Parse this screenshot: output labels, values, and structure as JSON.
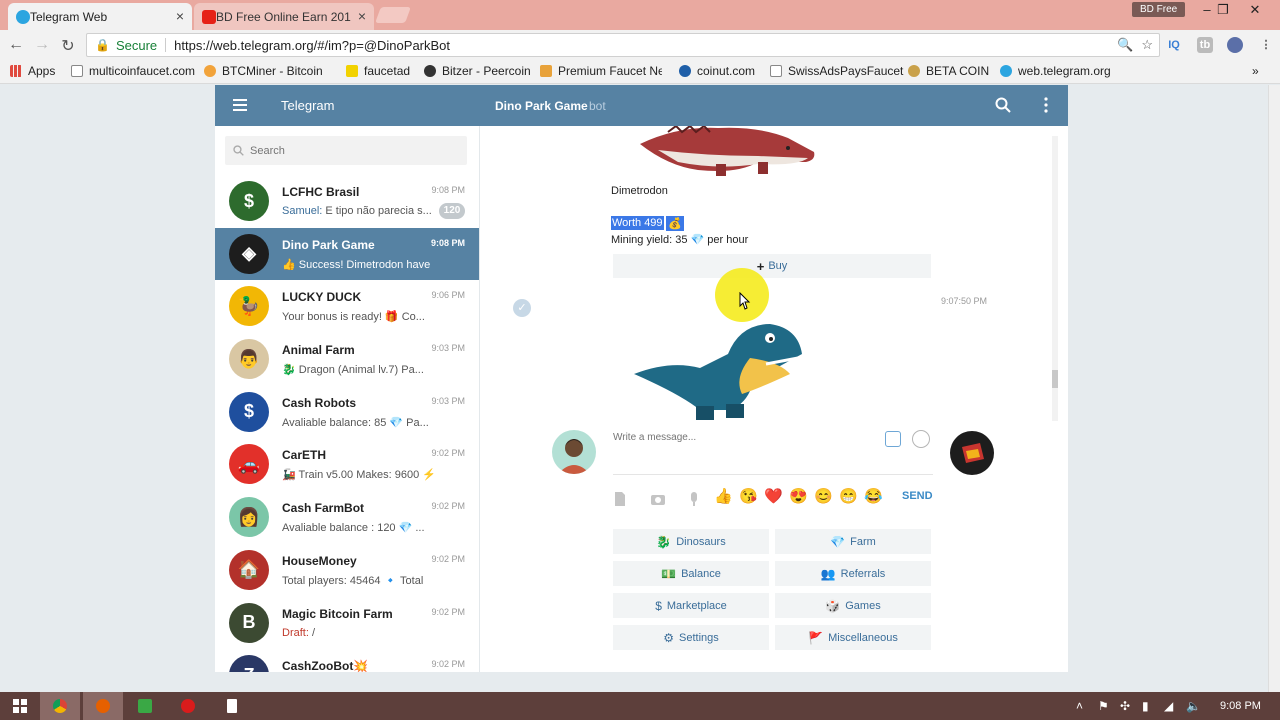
{
  "browser": {
    "tabs": [
      {
        "label": "Telegram Web",
        "active": true
      },
      {
        "label": "BD Free Online Earn 201",
        "active": false
      }
    ],
    "profile_name": "BD Free",
    "address": {
      "secure_label": "Secure",
      "url": "https://web.telegram.org/#/im?p=@DinoParkBot"
    },
    "extensions": [
      "IQ",
      "tb"
    ],
    "bookmarks": [
      {
        "label": "Apps",
        "color": "#e04a3f"
      },
      {
        "label": "multicoinfaucet.com",
        "color": "#ffffff"
      },
      {
        "label": "BTCMiner - Bitcoin m",
        "color": "#f2a33a"
      },
      {
        "label": "faucetad",
        "color": "#f2d200"
      },
      {
        "label": "Bitzer - Peercoin",
        "color": "#333333"
      },
      {
        "label": "Premium Faucet Netw",
        "color": "#e8a23a"
      },
      {
        "label": "coinut.com",
        "color": "#1f5fa8"
      },
      {
        "label": "SwissAdsPaysFaucet",
        "color": "#ffffff"
      },
      {
        "label": "BETA COIN",
        "color": "#c9a14a"
      },
      {
        "label": "web.telegram.org",
        "color": "#2ca5e0"
      }
    ]
  },
  "telegram": {
    "app_title": "Telegram",
    "peer": {
      "name": "Dino Park Game",
      "subtitle": "bot"
    },
    "search_placeholder": "Search",
    "dialogs": [
      {
        "name": "LCFHC Brasil",
        "time": "9:08 PM",
        "from": "Samuel:",
        "message": " E tipo não parecia s...",
        "badge": "120",
        "avatar_color": "#2d6b2d",
        "avatar_letter": "$"
      },
      {
        "name": "Dino Park Game",
        "time": "9:08 PM",
        "message": "👍 Success! Dimetrodon have",
        "active": true,
        "avatar_color": "#1d1d1d",
        "avatar_letter": "◈"
      },
      {
        "name": "LUCKY DUCK",
        "time": "9:06 PM",
        "message": "Your bonus is ready! 🎁 Co...",
        "avatar_color": "#f2b705",
        "avatar_letter": "🦆"
      },
      {
        "name": "Animal Farm",
        "time": "9:03 PM",
        "message": "🐉 Dragon (Animal lv.7) Pa...",
        "avatar_color": "#d9c7a3",
        "avatar_letter": "👨"
      },
      {
        "name": "Cash Robots",
        "time": "9:03 PM",
        "message": "Avaliable balance: 85 💎 Pa...",
        "avatar_color": "#1f4f9e",
        "avatar_letter": "$"
      },
      {
        "name": "CarETH",
        "time": "9:02 PM",
        "message": "🚂 Train v5.00 Makes: 9600 ⚡",
        "avatar_color": "#e2302a",
        "avatar_letter": "🚗"
      },
      {
        "name": "Cash FarmBot",
        "time": "9:02 PM",
        "message": "Avaliable balance : 120 💎 ...",
        "avatar_color": "#7bc6a8",
        "avatar_letter": "👩"
      },
      {
        "name": "HouseMoney",
        "time": "9:02 PM",
        "message": "Total players: 45464 🔹 Total",
        "avatar_color": "#b3312b",
        "avatar_letter": "🏠"
      },
      {
        "name": "Magic Bitcoin Farm",
        "time": "9:02 PM",
        "draft": "Draft:",
        "message": " /",
        "avatar_color": "#3c4a32",
        "avatar_letter": "B"
      },
      {
        "name": "CashZooBot💥",
        "time": "9:02 PM",
        "message": "",
        "avatar_color": "#2a3866",
        "avatar_letter": "Z"
      }
    ],
    "chat": {
      "dino_caption": "Dimetrodon",
      "worth_text": "Worth 499",
      "worth_icon": "💰",
      "mining_text": "Mining yield: 35",
      "mining_icon": "💎",
      "mining_unit": "per hour",
      "buy_label": "Buy",
      "message_time": "9:07:50 PM"
    },
    "composer": {
      "placeholder": "Write a message...",
      "send_label": "SEND",
      "emojis": [
        "👍",
        "😘",
        "❤️",
        "😍",
        "😊",
        "😁",
        "😂"
      ]
    },
    "keyboard": [
      {
        "icon": "🐉",
        "label": "Dinosaurs"
      },
      {
        "icon": "💎",
        "label": "Farm"
      },
      {
        "icon": "💵",
        "label": "Balance"
      },
      {
        "icon": "👥",
        "label": "Referrals"
      },
      {
        "icon": "$",
        "label": "Marketplace"
      },
      {
        "icon": "🎲",
        "label": "Games"
      },
      {
        "icon": "⚙",
        "label": "Settings"
      },
      {
        "icon": "🚩",
        "label": "Miscellaneous"
      }
    ]
  },
  "taskbar": {
    "clock": "9:08 PM"
  }
}
